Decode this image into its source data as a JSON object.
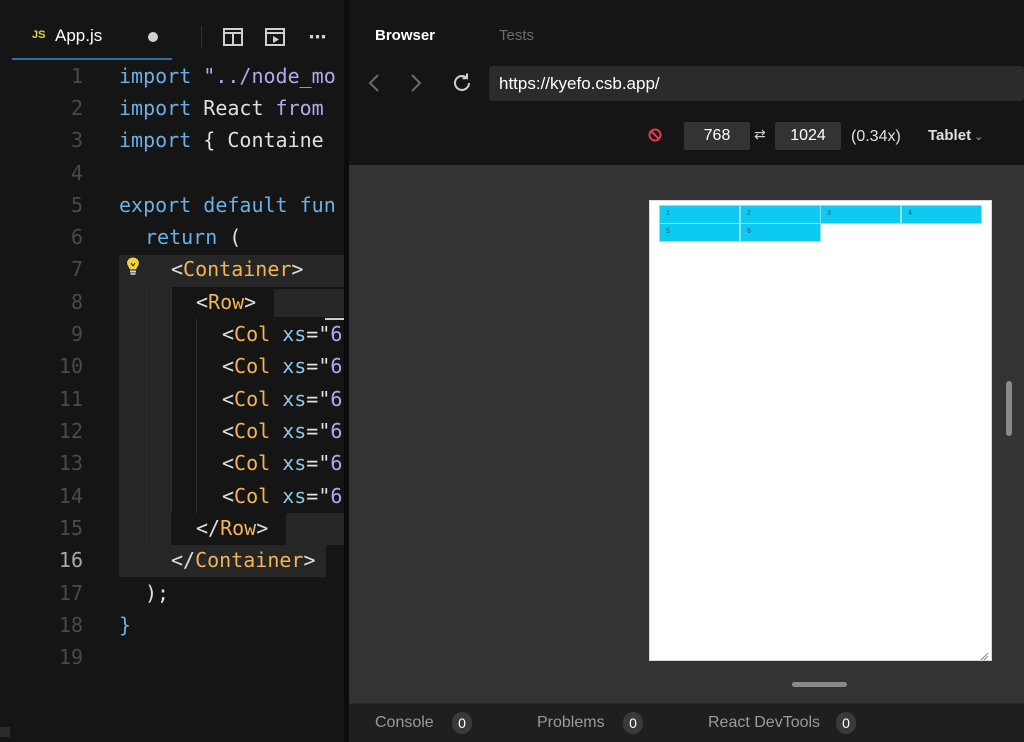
{
  "editor": {
    "file_tab": {
      "lang_badge": "JS",
      "filename": "App.js"
    },
    "code": {
      "line_numbers": [
        "1",
        "2",
        "3",
        "4",
        "5",
        "6",
        "7",
        "8",
        "9",
        "10",
        "11",
        "12",
        "13",
        "14",
        "15",
        "16",
        "17",
        "18",
        "19"
      ],
      "active_line": "16",
      "l1_kw": "import",
      "l1_str": " \"../node_mo",
      "l2_kw": "import",
      "l2_plain": " React ",
      "l2_kw2": "from",
      "l3_kw": "import",
      "l3_plain": " { Containe",
      "l5_kw": "export default fun",
      "l6_kw": "return",
      "l6_plain": " (",
      "l7_plain": "<",
      "l7_tag": "Container",
      "l7_end": ">",
      "l8_plain": "<",
      "l8_tag": "Row",
      "l8_end": ">",
      "col_lt": "<",
      "col_tag": "Col",
      "col_attr": " xs",
      "col_eq": "=",
      "col_quote": "\"",
      "col_tail": "6",
      "l15_plain": "</",
      "l15_tag": "Row",
      "l15_end": ">",
      "l16_plain": "</",
      "l16_tag": "Container",
      "l16_end": ">",
      "l17_plain": ");",
      "l18_plain": "}"
    }
  },
  "browser": {
    "tabs": {
      "browser": "Browser",
      "tests": "Tests"
    },
    "url": "https://kyefo.csb.app/",
    "device": {
      "width": "768",
      "height": "1024",
      "zoom": "(0.34x)",
      "preset": "Tablet",
      "swap_symbol": "⇄"
    },
    "preview_cells": [
      "1",
      "2",
      "3",
      "4",
      "5",
      "6"
    ],
    "bottom_tabs": {
      "console": {
        "label": "Console",
        "count": "0"
      },
      "problems": {
        "label": "Problems",
        "count": "0"
      },
      "devtools": {
        "label": "React DevTools",
        "count": "0"
      }
    }
  },
  "colors": {
    "keyword": "#6ab0e8",
    "string": "#b7a6f0",
    "tag": "#f2b454",
    "preview_col": "#0dcaf0",
    "js_badge": "#e7d049"
  },
  "icons": [
    "split-view-icon",
    "preview-icon",
    "more-icon",
    "back-icon",
    "forward-icon",
    "reload-icon",
    "no-entry-icon",
    "swap-icon",
    "chevron-down-icon",
    "lightbulb-icon",
    "resize-grip-icon"
  ]
}
